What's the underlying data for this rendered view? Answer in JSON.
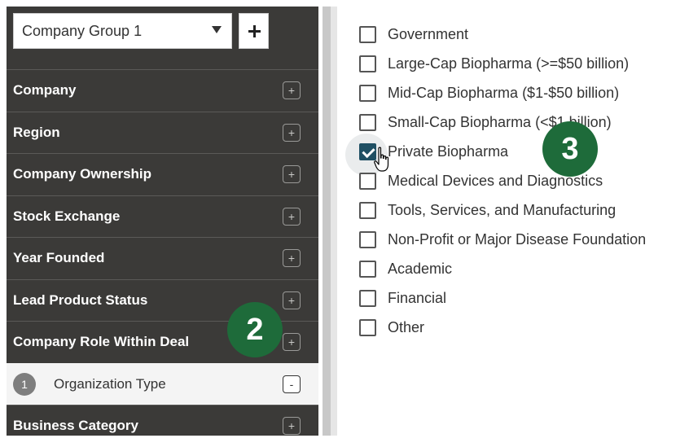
{
  "company_group": {
    "selected": "Company Group 1",
    "add_label": "+"
  },
  "sidebar": {
    "items": [
      {
        "label": "Company",
        "toggle": "+"
      },
      {
        "label": "Region",
        "toggle": "+"
      },
      {
        "label": "Company Ownership",
        "toggle": "+"
      },
      {
        "label": "Stock Exchange",
        "toggle": "+"
      },
      {
        "label": "Year Founded",
        "toggle": "+"
      },
      {
        "label": "Lead Product Status",
        "toggle": "+"
      },
      {
        "label": "Company Role Within Deal",
        "toggle": "+"
      },
      {
        "label": "Organization Type",
        "toggle": "-",
        "badge": "1",
        "active": true
      },
      {
        "label": "Business Category",
        "toggle": "+"
      }
    ]
  },
  "options": [
    {
      "label": "Government",
      "checked": false
    },
    {
      "label": "Large-Cap Biopharma (>=$50 billion)",
      "checked": false
    },
    {
      "label": "Mid-Cap Biopharma ($1-$50 billion)",
      "checked": false
    },
    {
      "label": "Small-Cap Biopharma (<$1 billion)",
      "checked": false
    },
    {
      "label": "Private Biopharma",
      "checked": true
    },
    {
      "label": "Medical Devices and Diagnostics",
      "checked": false
    },
    {
      "label": "Tools, Services, and Manufacturing",
      "checked": false
    },
    {
      "label": "Non-Profit or Major Disease Foundation",
      "checked": false
    },
    {
      "label": "Academic",
      "checked": false
    },
    {
      "label": "Financial",
      "checked": false
    },
    {
      "label": "Other",
      "checked": false
    }
  ],
  "steps": {
    "two": "2",
    "three": "3"
  },
  "colors": {
    "sidebar_bg": "#3b3a38",
    "step_badge": "#1e6b3a",
    "checkbox_checked": "#1f4f63"
  }
}
